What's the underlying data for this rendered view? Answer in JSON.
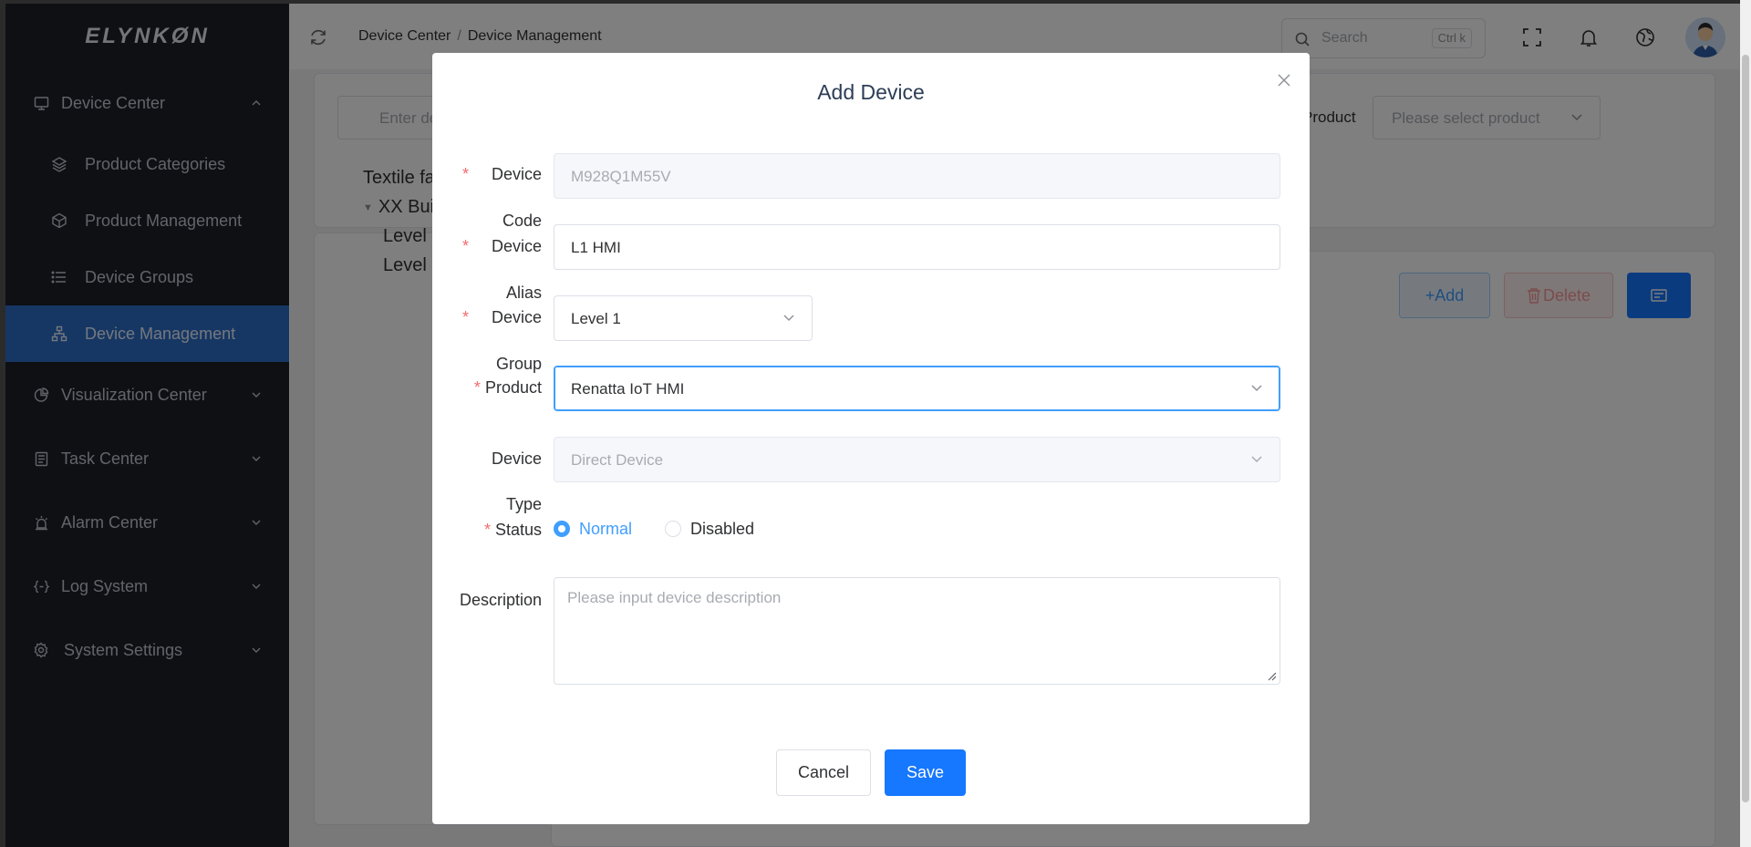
{
  "app": {
    "logo_text": "ELYNKØN"
  },
  "sidebar": {
    "items": [
      {
        "label": "Device Center",
        "icon": "monitor-icon",
        "expanded": true
      },
      {
        "label": "Product Categories",
        "icon": "layers-icon"
      },
      {
        "label": "Product Management",
        "icon": "cube-icon"
      },
      {
        "label": "Device Groups",
        "icon": "list-icon"
      },
      {
        "label": "Device Management",
        "icon": "sitemap-icon",
        "active": true
      },
      {
        "label": "Visualization Center",
        "icon": "pie-chart-icon"
      },
      {
        "label": "Task Center",
        "icon": "clipboard-icon"
      },
      {
        "label": "Alarm Center",
        "icon": "alarm-icon"
      },
      {
        "label": "Log System",
        "icon": "braces-icon"
      },
      {
        "label": "System Settings",
        "icon": "gear-icon"
      }
    ]
  },
  "header": {
    "breadcrumb": [
      "Device Center",
      "Device Management"
    ],
    "breadcrumb_separator": "/",
    "search_placeholder": "Search",
    "search_shortcut": "Ctrl k"
  },
  "background": {
    "search_placeholder": "Enter de",
    "product_label": "Product",
    "product_placeholder": "Please select product",
    "tree": [
      "Textile fa",
      "XX Build",
      "Level",
      "Level"
    ],
    "add_button": "+Add",
    "delete_button": "Delete"
  },
  "dialog": {
    "title": "Add Device",
    "fields": {
      "device_code": {
        "label_lines": [
          "Device",
          "Code"
        ],
        "required": true,
        "value": "M928Q1M55V",
        "disabled": true
      },
      "device_alias": {
        "label_lines": [
          "Device",
          "Alias"
        ],
        "required": true,
        "value": "L1 HMI"
      },
      "device_group": {
        "label_lines": [
          "Device",
          "Group"
        ],
        "required": true,
        "value": "Level 1"
      },
      "product": {
        "label": "Product",
        "required": true,
        "value": "Renatta IoT HMI"
      },
      "device_type": {
        "label_lines": [
          "Device",
          "Type"
        ],
        "value": "Direct Device",
        "disabled": true
      },
      "status": {
        "label": "Status",
        "required": true,
        "options": [
          "Normal",
          "Disabled"
        ],
        "selected": "Normal"
      },
      "description": {
        "label": "Description",
        "placeholder": "Please input device description"
      }
    },
    "cancel_label": "Cancel",
    "save_label": "Save"
  },
  "colors": {
    "primary": "#1677ff",
    "sidebar_bg": "#1d2029",
    "sidebar_active": "#2d6fc9",
    "required": "#f56c6c"
  }
}
